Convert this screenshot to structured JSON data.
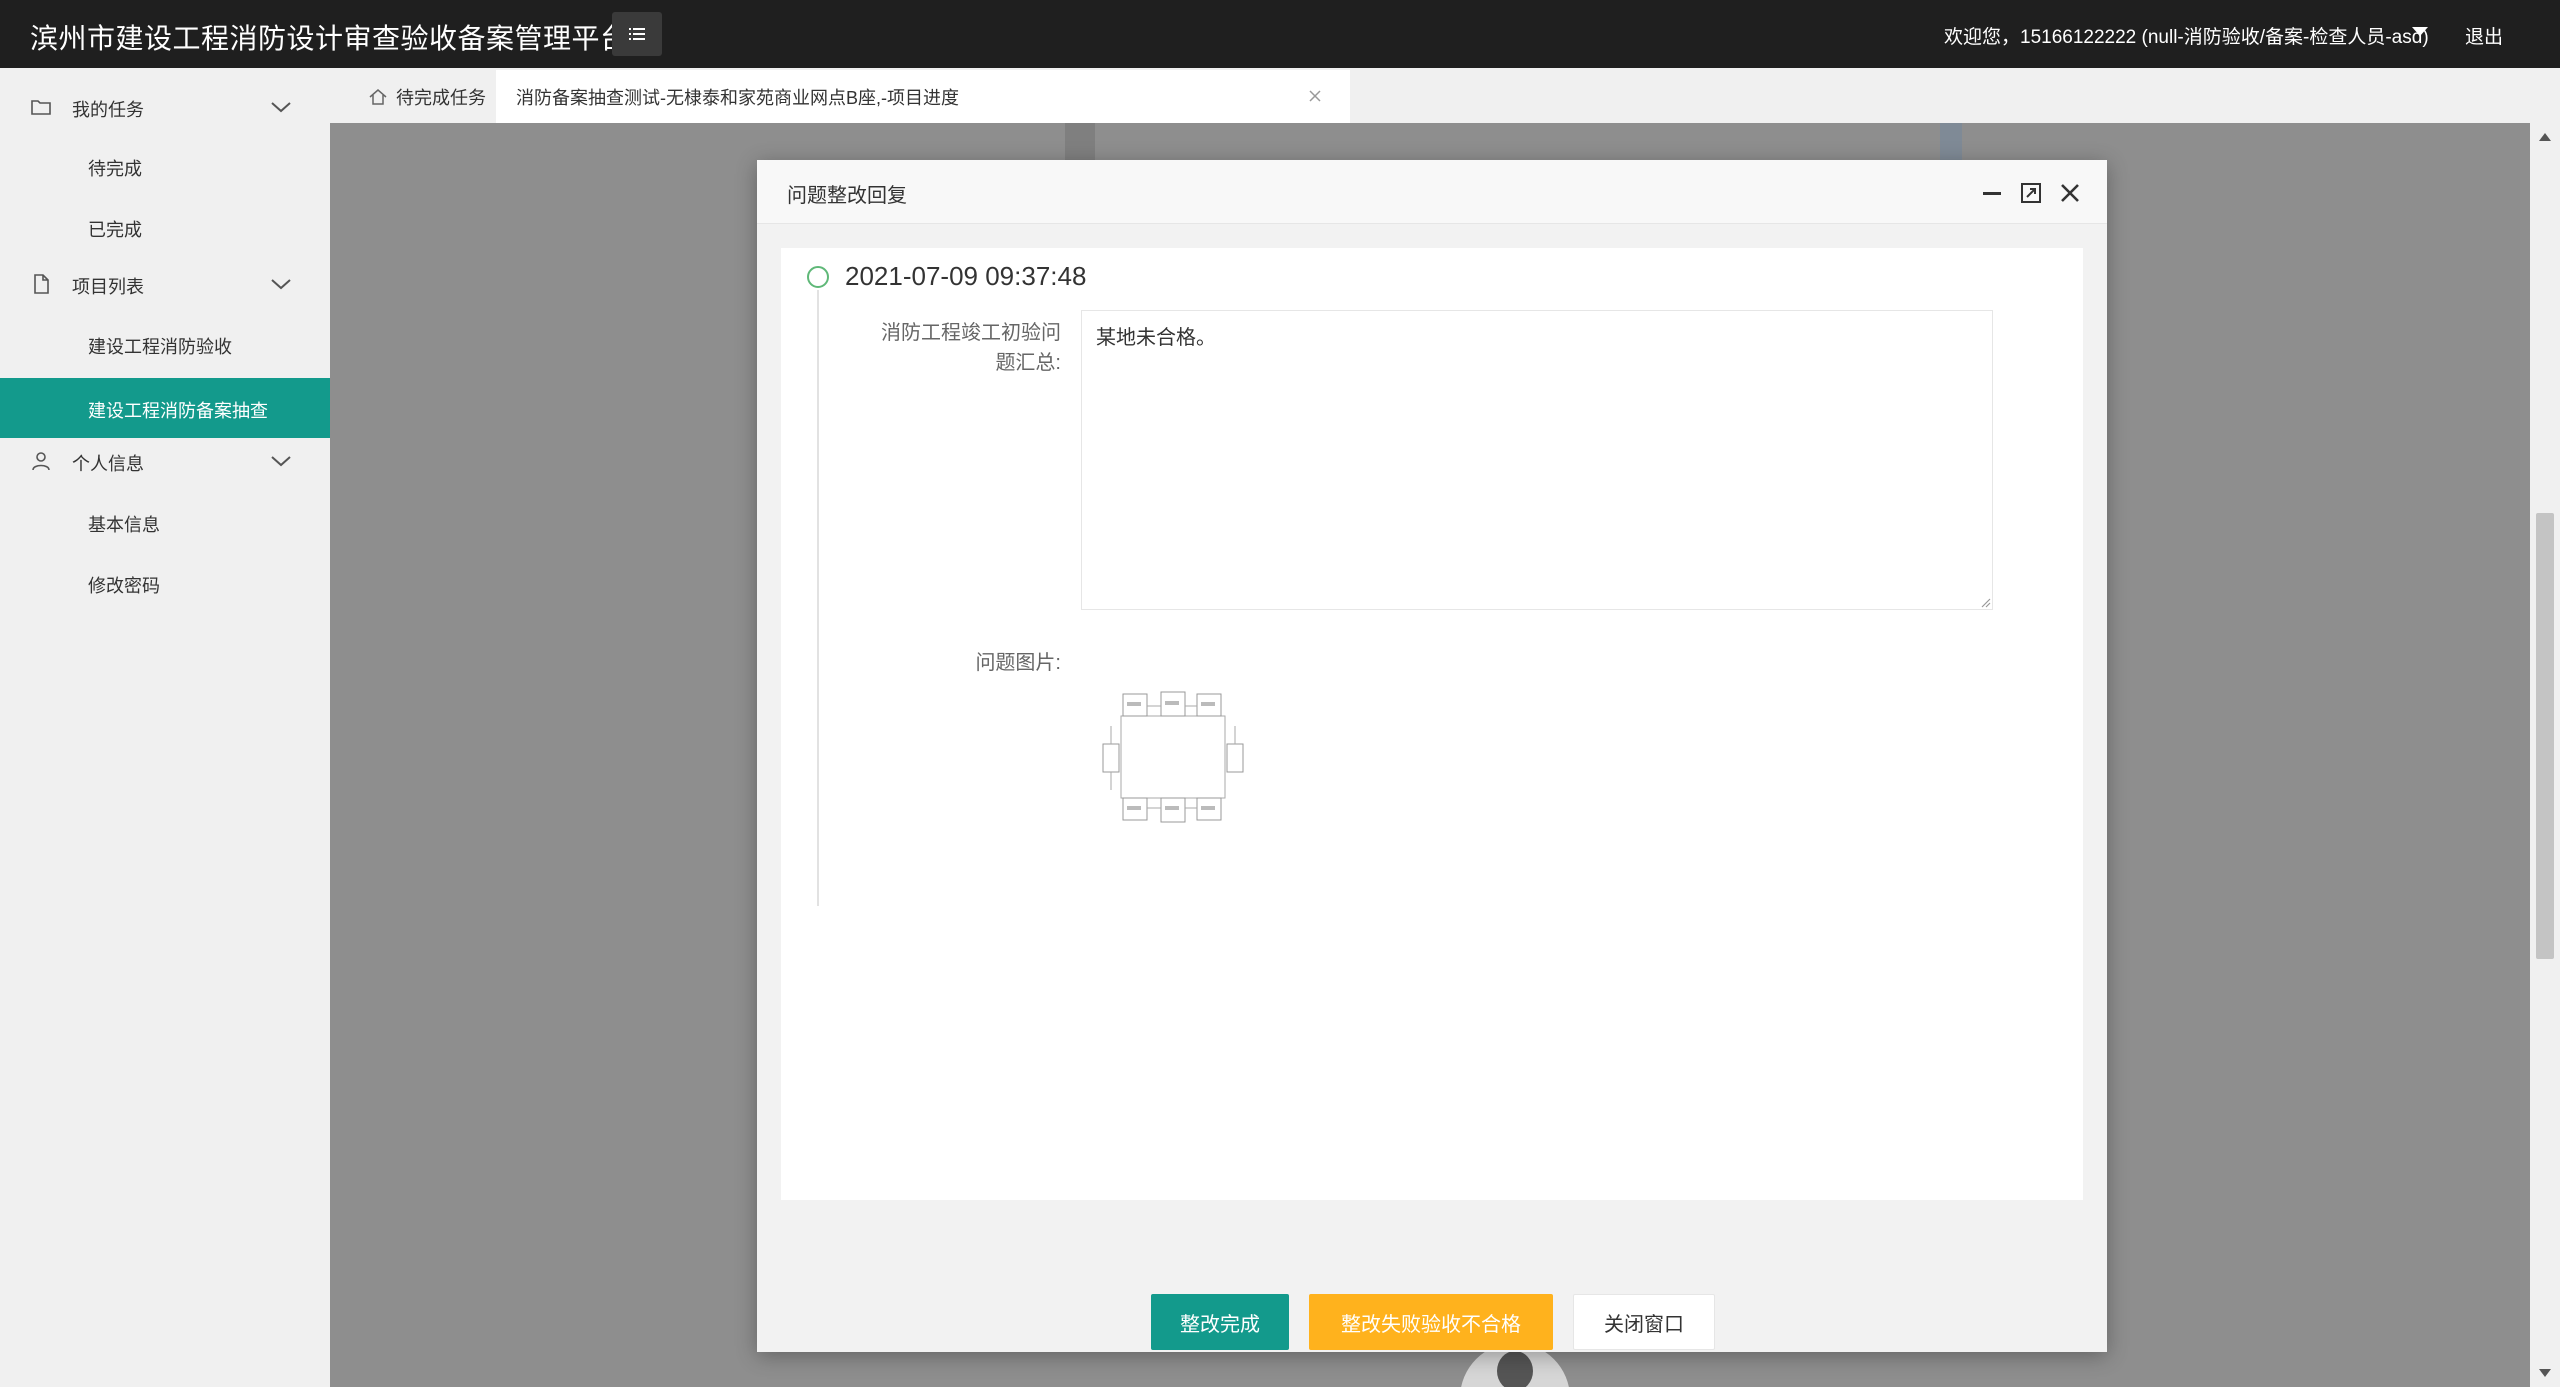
{
  "header": {
    "app_title": "滨州市建设工程消防设计审查验收备案管理平台",
    "welcome_text": "欢迎您，15166122222 (null-消防验收/备案-检查人员-asd)",
    "logout_label": "退出"
  },
  "sidebar": {
    "groups": [
      {
        "label": "我的任务",
        "icon": "folder-icon",
        "items": [
          {
            "label": "待完成"
          },
          {
            "label": "已完成"
          }
        ]
      },
      {
        "label": "项目列表",
        "icon": "document-icon",
        "items": [
          {
            "label": "建设工程消防验收"
          },
          {
            "label": "建设工程消防备案抽查",
            "active": true
          }
        ]
      },
      {
        "label": "个人信息",
        "icon": "user-icon",
        "items": [
          {
            "label": "基本信息"
          },
          {
            "label": "修改密码"
          }
        ]
      }
    ]
  },
  "tabs": [
    {
      "label": "待完成任务",
      "icon": "home-icon"
    },
    {
      "label": "消防备案抽查测试-无棣泰和家苑商业网点B座,-项目进度",
      "active": true
    }
  ],
  "modal": {
    "title": "问题整改回复",
    "timestamp": "2021-07-09 09:37:48",
    "summary_label": "消防工程竣工初验问题汇总:",
    "summary_text": "某地未合格。",
    "image_label": "问题图片:",
    "buttons": {
      "done": "整改完成",
      "fail": "整改失败验收不合格",
      "close": "关闭窗口"
    }
  },
  "colors": {
    "topbar": "#1f1f1f",
    "accent": "#139a8c",
    "warning": "#ffb21d",
    "timeline_dot": "#5fb878"
  }
}
